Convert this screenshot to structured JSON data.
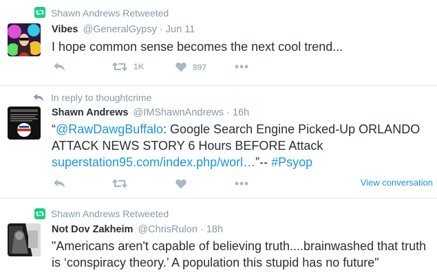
{
  "colors": {
    "retweet_green": "#19cf86",
    "link_blue": "#1b95e0",
    "muted_gray": "#8899a6",
    "action_gray": "#aab8c2"
  },
  "tweets": [
    {
      "context_icon": "retweet-icon",
      "context_text": "Shawn Andrews Retweeted",
      "name": "Vibes",
      "handle": "@GeneralGypsy",
      "separator": "·",
      "time": "Jun 11",
      "text": "I hope common sense becomes the next cool trend...",
      "actions": {
        "reply_icon": "reply-icon",
        "retweet_icon": "retweet-icon",
        "retweet_count": "1K",
        "like_icon": "heart-icon",
        "like_count": "897",
        "more_icon": "more-icon"
      }
    },
    {
      "context_icon": "reply-arrow-icon",
      "context_text": "In reply to thoughtcrime",
      "name": "Shawn Andrews",
      "handle": "@IMShawnAndrews",
      "separator": "·",
      "time": "16h",
      "text_parts": {
        "open_quote": "“",
        "mention": "@RawDawgBuffalo",
        "body": ": Google Search Engine Picked-Up ORLANDO ATTACK NEWS STORY 6 Hours BEFORE Attack ",
        "url": "superstation95.com/index.php/worl…",
        "after_url": "”-- ",
        "hashtag": "#Psyop"
      },
      "view_conversation": "View conversation",
      "actions": {
        "reply_icon": "reply-icon",
        "retweet_icon": "retweet-icon",
        "like_icon": "heart-icon",
        "more_icon": "more-icon"
      }
    },
    {
      "context_icon": "retweet-icon",
      "context_text": "Shawn Andrews Retweeted",
      "name": "Not Dov Zakheim",
      "handle": "@ChrisRulon",
      "separator": "·",
      "time": "18h",
      "text": "\"Americans aren't capable of believing truth....brainwashed that truth is ‘conspiracy theory.’ A population this stupid has no future\""
    }
  ]
}
